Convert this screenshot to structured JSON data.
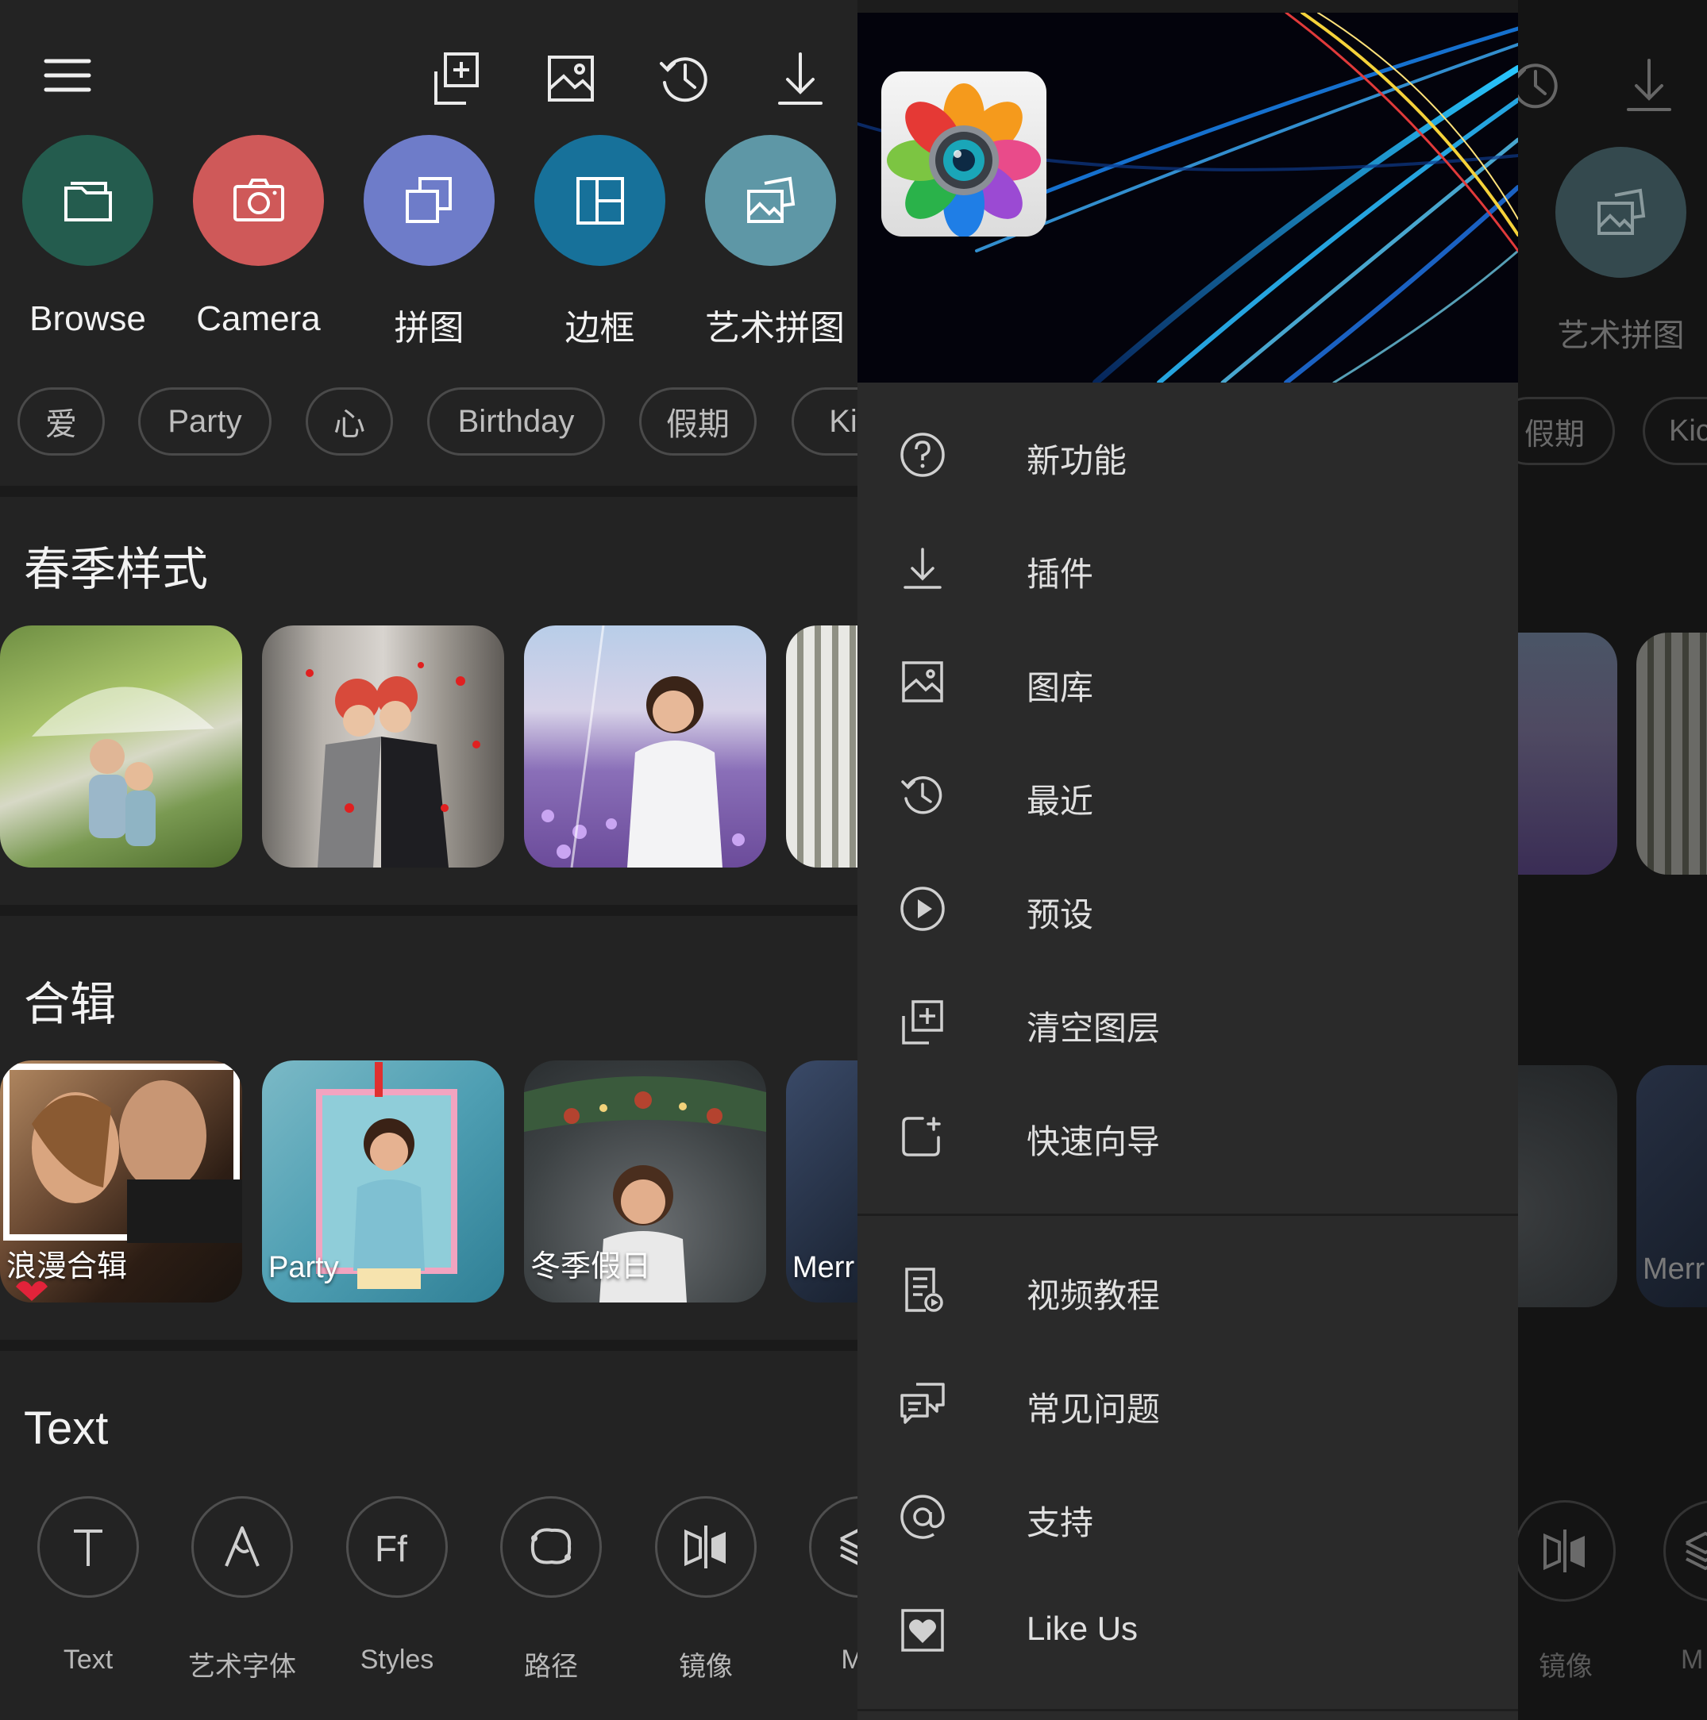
{
  "toolbar": {
    "menu": "hamburger-menu-icon",
    "items": [
      "add-layer-icon",
      "gallery-icon",
      "history-icon",
      "download-icon"
    ]
  },
  "features": [
    {
      "label": "Browse",
      "color": "#245c4e"
    },
    {
      "label": "Camera",
      "color": "#cf5959"
    },
    {
      "label": "拼图",
      "color": "#6e7cc9"
    },
    {
      "label": "边框",
      "color": "#17719a"
    },
    {
      "label": "艺术拼图",
      "color": "#5e97a6"
    }
  ],
  "chips": [
    "爱",
    "Party",
    "心",
    "Birthday",
    "假期",
    "Kic"
  ],
  "sections": {
    "spring": {
      "title": "春季样式"
    },
    "collections": {
      "title": "合辑",
      "items": [
        "浪漫合辑",
        "Party",
        "冬季假日",
        "Merr"
      ]
    },
    "text": {
      "title": "Text",
      "tools": [
        "Text",
        "艺术字体",
        "Styles",
        "路径",
        "镜像",
        "Ma"
      ]
    }
  },
  "drawer": {
    "menu": [
      "新功能",
      "插件",
      "图库",
      "最近",
      "预设",
      "清空图层",
      "快速向导"
    ],
    "support": [
      "视频教程",
      "常见问题",
      "支持",
      "Like Us"
    ]
  },
  "background_right": {
    "feature_label": "艺术拼图",
    "chips": [
      "假期",
      "Kic"
    ],
    "caption": "Merr",
    "tool_labels": [
      "镜像",
      "M"
    ]
  }
}
